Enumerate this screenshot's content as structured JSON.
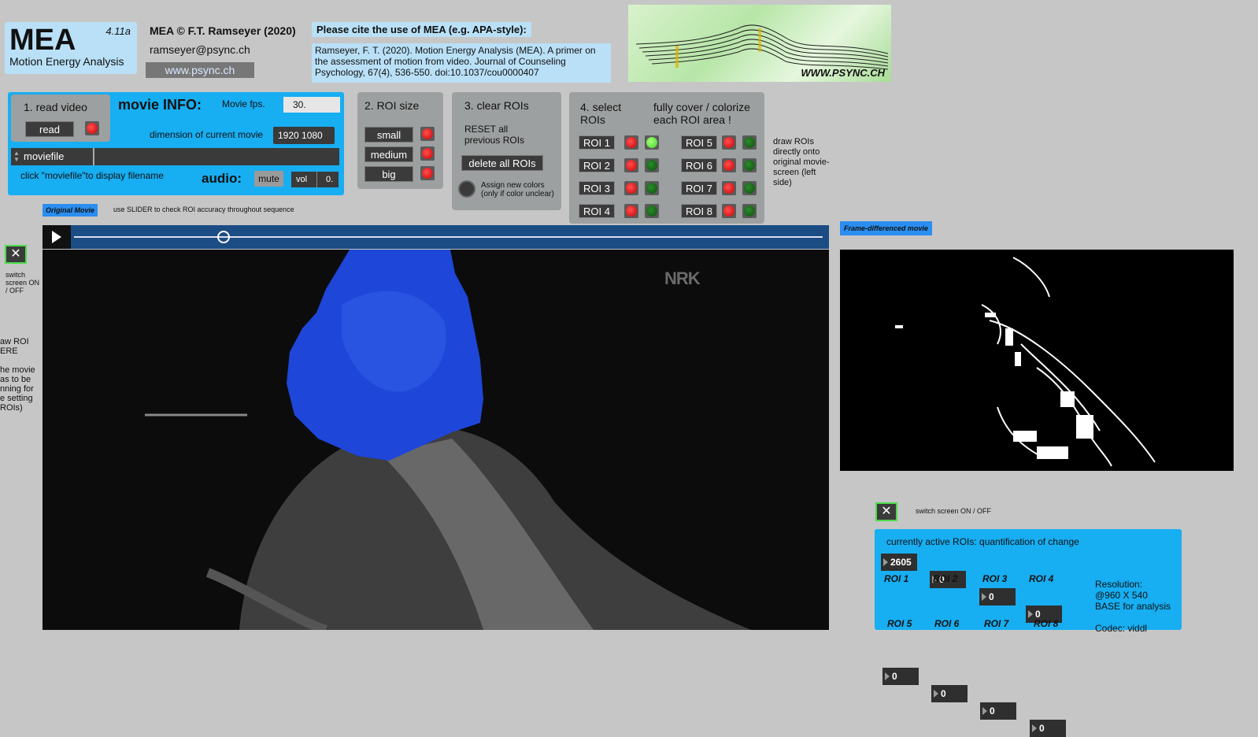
{
  "brand": {
    "title": "MEA",
    "version": "4.11a",
    "subtitle": "Motion Energy Analysis"
  },
  "author": {
    "copyright": "MEA © F.T. Ramseyer (2020)",
    "email": "ramseyer@psync.ch",
    "website": "www.psync.ch"
  },
  "cite": {
    "heading": "Please cite the use of MEA (e.g. APA-style):",
    "text": "Ramseyer, F. T. (2020). Motion Energy Analysis (MEA). A primer on the assessment of motion from video. Journal of Counseling Psychology, 67(4), 536-550. doi:10.1037/cou0000407"
  },
  "logo": {
    "text": "WWW.PSYNC.CH"
  },
  "read_panel": {
    "step_label": "1. read video",
    "read_button": "read",
    "movie_info_title": "movie INFO:",
    "fps_label": "Movie fps.",
    "fps_value": "30.",
    "dimension_label": "dimension of current movie",
    "dimension_value": "1920 1080",
    "moviefile_label": "moviefile",
    "hint": "click \"moviefile\"to display  filename",
    "audio_label": "audio:",
    "mute_button": "mute",
    "vol_label": "vol",
    "vol_value": "0."
  },
  "roi_size": {
    "title": "2. ROI size",
    "small": "small",
    "medium": "medium",
    "big": "big"
  },
  "clear_rois": {
    "title": "3. clear ROIs",
    "reset_text": "RESET all previous ROIs",
    "delete_button": "delete all ROIs",
    "assign_text": "Assign new colors (only if color unclear)"
  },
  "select_rois": {
    "title": "4. select ROIs",
    "instruction": "fully cover / colorize each ROI area !",
    "rois": [
      "ROI 1",
      "ROI 2",
      "ROI 3",
      "ROI 4",
      "ROI 5",
      "ROI 6",
      "ROI 7",
      "ROI 8"
    ]
  },
  "draw_note": "draw ROIs directly onto original movie-screen (left side)",
  "original_movie": {
    "tag": "Original Movie",
    "hint": "use SLIDER to check ROI accuracy throughout sequence",
    "slider_position": 0.2
  },
  "left_side": {
    "switch_text": "switch screen ON / OFF",
    "draw_text": "aw ROI ERE\n\nhe movie as to be nning for e setting ROIs)"
  },
  "frame_diff": {
    "tag": "Frame-differenced movie",
    "switch_text": "switch screen ON / OFF"
  },
  "watermark": "NRK",
  "quantification": {
    "title": "currently active ROIs: quantification of change",
    "values": [
      "2605",
      "0",
      "0",
      "0",
      "0",
      "0",
      "0",
      "0"
    ],
    "labels": [
      "ROI 1",
      "ROI 2",
      "ROI 3",
      "ROI 4",
      "ROI 5",
      "ROI 6",
      "ROI 7",
      "ROI 8"
    ],
    "resolution_text": "Resolution:\n@960 X 540\nBASE for analysis\n\nCodec: viddl"
  },
  "colors": {
    "accent_blue": "#17aef2",
    "light_blue": "#b9e0f7",
    "roi_blue": "#1e46d8",
    "led_red": "#e00000",
    "led_green": "#1e7a1e"
  }
}
